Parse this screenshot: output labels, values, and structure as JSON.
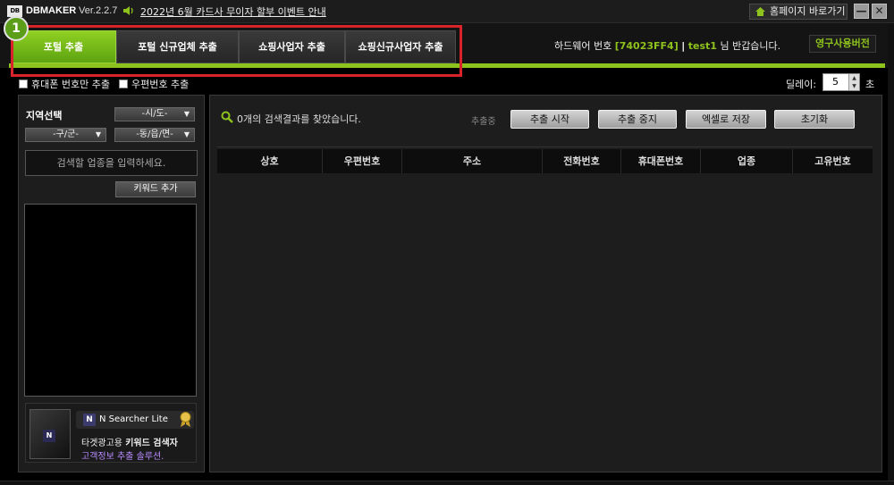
{
  "titlebar": {
    "logo": "DB",
    "app_name": "DBMAKER",
    "version": "Ver.2.2.7",
    "notice": "2022년 6월 카드사 무이자 할부 이벤트 안내",
    "home_button": "홈페이지 바로가기",
    "minimize": "—",
    "close": "✕"
  },
  "step_badge": "1",
  "tabs": [
    {
      "label": "포털 추출",
      "active": true
    },
    {
      "label": "포털 신규업체 추출",
      "active": false
    },
    {
      "label": "쇼핑사업자 추출",
      "active": false
    },
    {
      "label": "쇼핑신규사업자 추출",
      "active": false
    }
  ],
  "header_info": {
    "hw_label": "하드웨어 번호",
    "hw_id": "[74023FF4]",
    "separator": "|",
    "user": "test1",
    "greeting": "님 반갑습니다.",
    "license": "영구사용버전"
  },
  "options": {
    "mobile_only": "휴대폰 번호만 추출",
    "postcode": "우편번호 추출",
    "delay_label": "딜레이:",
    "delay_value": "5",
    "delay_unit": "초"
  },
  "region": {
    "title": "지역선택",
    "sido": "-시/도-",
    "gugun": "-구/군-",
    "dong": "-동/읍/면-"
  },
  "keyword": {
    "placeholder": "검색할 업종을 입력하세요.",
    "add_button": "키워드 추가"
  },
  "ad": {
    "box_logo": "N",
    "logo_letter": "N",
    "brand": "N Searcher Lite",
    "line1_prefix": "타겟광고용 ",
    "line1_bold": "키워드 검색자",
    "line2": "고객정보 추출 솔루션."
  },
  "results": {
    "count_text": "0개의 검색결과를 찾았습니다.",
    "status": "추출중",
    "buttons": [
      "추출 시작",
      "추출 중지",
      "엑셀로 저장",
      "초기화"
    ],
    "columns": [
      "상호",
      "우편번호",
      "주소",
      "전화번호",
      "휴대폰번호",
      "업종",
      "고유번호"
    ],
    "rows": []
  },
  "colors": {
    "accent_green": "#8ec21d",
    "highlight_red": "#d9232b",
    "background": "#000000"
  }
}
